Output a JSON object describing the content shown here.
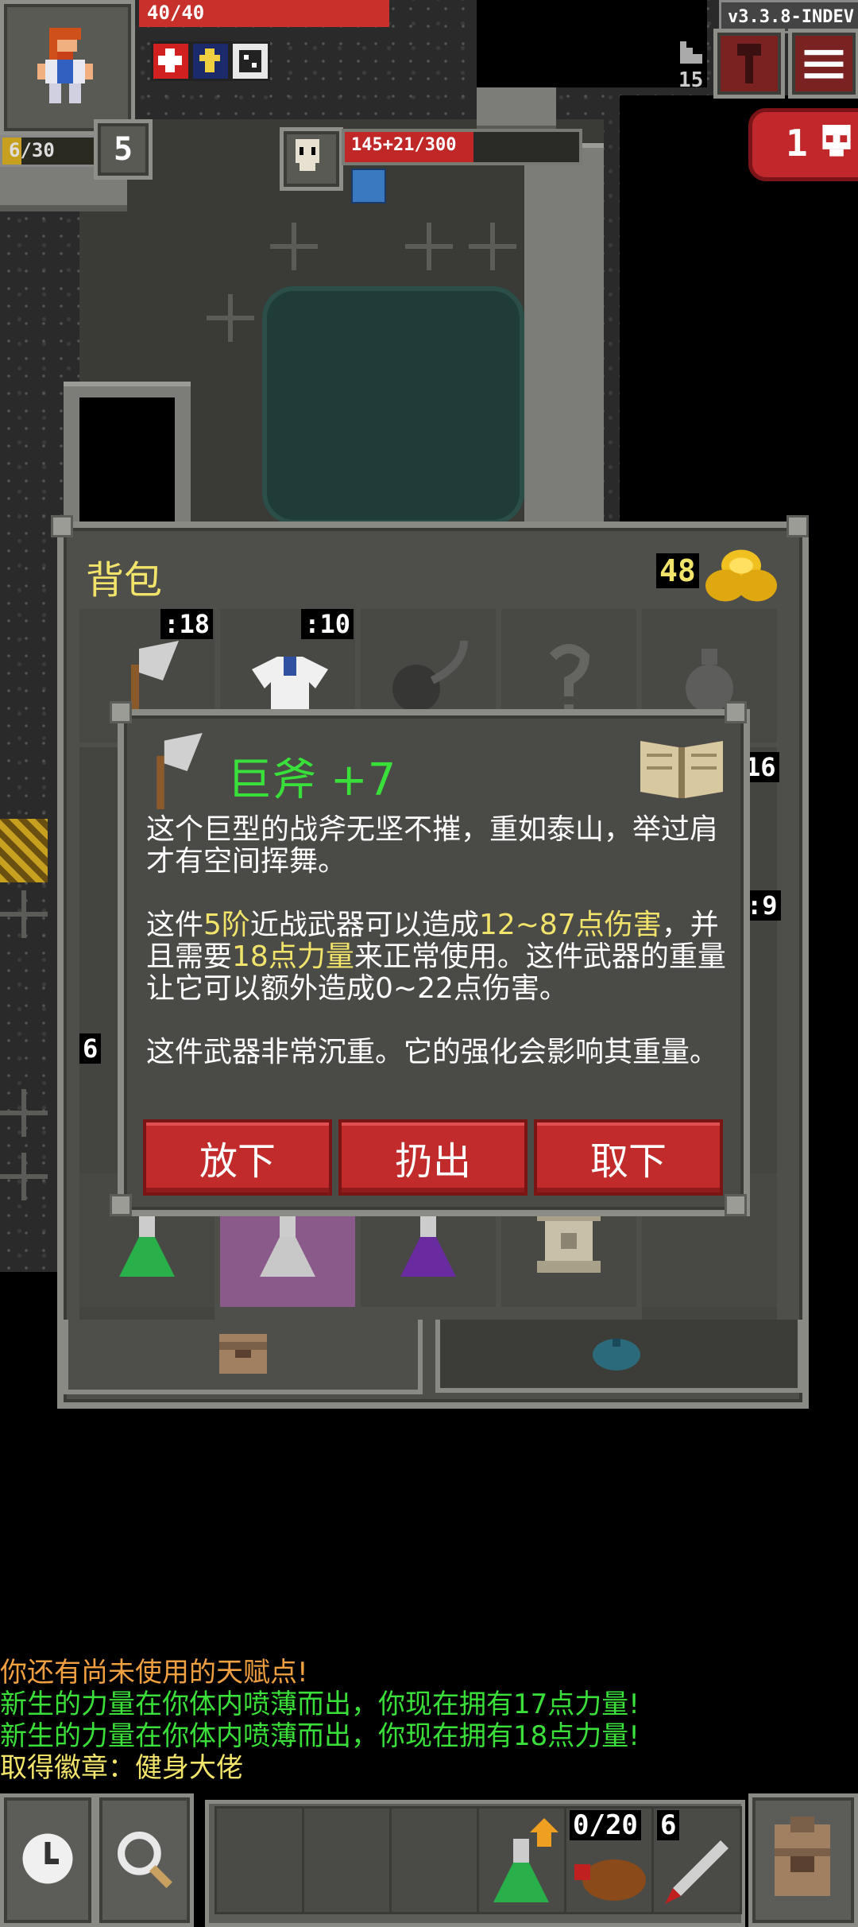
{
  "hud": {
    "hp_text": "40/40",
    "hp_fraction": 1.0,
    "exp_text": "6/30",
    "exp_fraction": 0.2,
    "level": "5",
    "version": "v3.3.8-INDEV",
    "depth": "15",
    "danger_count": "1",
    "buffs": [
      "medical-cross-icon",
      "blessed-icon",
      "dice-icon"
    ]
  },
  "enemy": {
    "health_text": "145+21/300",
    "health_fraction": 0.55
  },
  "inventory": {
    "title": "背包",
    "gold": "48",
    "top_row": [
      {
        "icon": "greataxe-icon",
        "qty": ":18"
      },
      {
        "icon": "cloth-armor-icon",
        "qty": ":10"
      },
      {
        "icon": "ring-slot-icon",
        "qty": ""
      },
      {
        "icon": "artifact-slot-icon",
        "qty": ""
      },
      {
        "icon": "misc-slot-icon",
        "qty": ""
      }
    ],
    "side_labels": {
      "right_top": "16",
      "right_mid": ":9",
      "left_mid": "6"
    },
    "bottom_row": [
      {
        "icon": "green-potion-icon"
      },
      {
        "icon": "white-potion-icon"
      },
      {
        "icon": "purple-potion-icon"
      },
      {
        "icon": "scroll-icon"
      },
      {
        "icon": "empty-slot"
      }
    ],
    "bags": [
      "backpack-tab-icon",
      "seed-pouch-tab-icon"
    ]
  },
  "dialog": {
    "title": "巨斧 +7",
    "title_color": "#3ae03a",
    "desc1": "这个巨型的战斧无坚不摧，重如泰山，举过肩才有空间挥舞。",
    "desc2_parts": [
      "这件",
      "5阶",
      "近战武器可以造成",
      "12~87点伤害",
      "，并且需要",
      "18点力量",
      "来正常使用。这件武器的重量让它可以额外造成0~22点伤害。"
    ],
    "desc3": "这件武器非常沉重。它的强化会影响其重量。",
    "buttons": {
      "drop": "放下",
      "throw": "扔出",
      "unequip": "取下"
    }
  },
  "log": [
    {
      "text": "你还有尚未使用的天赋点!",
      "color": "#f0a040"
    },
    {
      "text": "新生的力量在你体内喷薄而出，你现在拥有17点力量!",
      "color": "#3adf3a"
    },
    {
      "text": "新生的力量在你体内喷薄而出，你现在拥有18点力量!",
      "color": "#3adf3a"
    },
    {
      "text": "取得徽章：健身大佬",
      "color": "#f2e46b"
    }
  ],
  "toolbar": {
    "wait": "clock-icon",
    "search": "magnifier-icon",
    "dart_count": "0/20",
    "quick_count": "6",
    "backpack": "backpack-icon"
  }
}
